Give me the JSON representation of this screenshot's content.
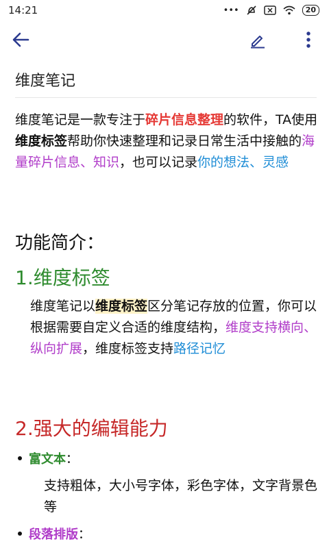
{
  "status": {
    "time": "14:21",
    "icons": "··· ",
    "battery": "20"
  },
  "toolbar": {
    "back": "back-arrow-icon",
    "edit": "pencil-icon",
    "more": "more-vert-icon"
  },
  "note": {
    "title": "维度笔记",
    "para1": {
      "t1": "维度笔记是一款专注于",
      "t2": "碎片信息整理",
      "t3": "的软件，TA使用",
      "t4": "维度标签",
      "t5": "帮助你快速整理和记录日常生活中接触的",
      "t6": "海量碎片信息、知识",
      "t7": "，也可以记录",
      "t8": "你的想法、灵感"
    },
    "intro_heading": "功能简介：",
    "section1": {
      "heading": "1.维度标签",
      "t1": "维度笔记以",
      "t2": "维度标签",
      "t3": "区分笔记存放的位置，你可以根据需要自定义合适的维度结构，",
      "t4": "维度支持横向、纵向扩展",
      "t5": "，维度标签支持",
      "t6": "路径记忆"
    },
    "section2": {
      "heading": "2.强大的编辑能力",
      "bullet1_label": "富文本",
      "bullet1_colon": "：",
      "bullet1_text": "支持粗体，大小号字体，彩色字体，文字背景色等",
      "bullet2_label": "段落排版",
      "bullet2_colon": "："
    }
  }
}
